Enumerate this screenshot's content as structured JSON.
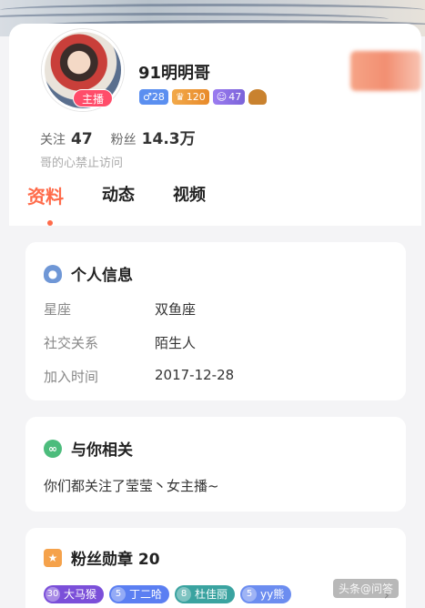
{
  "profile": {
    "nickname": "91明明哥",
    "live_badge": "主播",
    "gender_age": "♂28",
    "level_badge_1": "120",
    "level_badge_2": "47",
    "follow_label": "关注",
    "follow_count": "47",
    "fans_label": "粉丝",
    "fans_count": "14.3万",
    "bio": "哥的心禁止访问"
  },
  "tabs": [
    "资料",
    "动态",
    "视频"
  ],
  "personal_info": {
    "title": "个人信息",
    "rows": [
      {
        "key": "星座",
        "value": "双鱼座"
      },
      {
        "key": "社交关系",
        "value": "陌生人"
      },
      {
        "key": "加入时间",
        "value": "2017-12-28"
      }
    ]
  },
  "related": {
    "title": "与你相关",
    "text": "你们都关注了莹莹丶女主播~"
  },
  "fan_medals": {
    "title": "粉丝勋章 20",
    "items": [
      {
        "level": "30",
        "name": "大马猴"
      },
      {
        "level": "5",
        "name": "丁二哈"
      },
      {
        "level": "8",
        "name": "杜佳丽"
      },
      {
        "level": "5",
        "name": "yy熊"
      }
    ]
  },
  "watermark": "头条@问答"
}
